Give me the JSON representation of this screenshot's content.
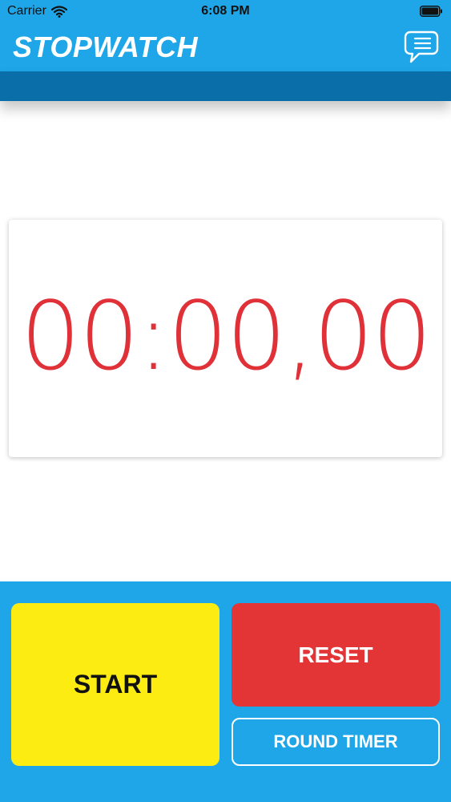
{
  "status_bar": {
    "carrier": "Carrier",
    "time": "6:08 PM"
  },
  "header": {
    "title": "STOPWATCH",
    "menu_icon": "chat-menu-icon"
  },
  "timer": {
    "display": "00:00,00"
  },
  "controls": {
    "start_label": "START",
    "reset_label": "RESET",
    "round_timer_label": "ROUND TIMER"
  },
  "colors": {
    "header": "#1ea6e8",
    "subbar": "#0a6ea9",
    "timer_text": "#e03038",
    "start": "#fcec12",
    "reset": "#e33436"
  }
}
